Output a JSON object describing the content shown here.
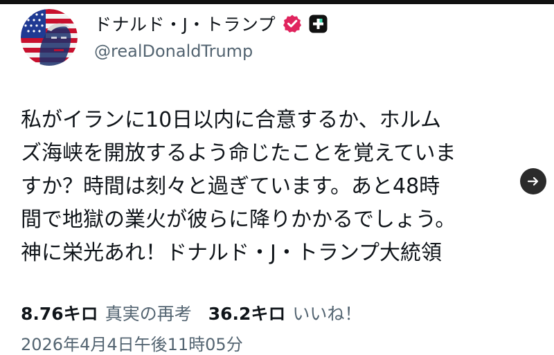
{
  "author": {
    "display_name": "ドナルド・J・トランプ",
    "handle": "@realDonaldTrump",
    "avatar_icon": "flag-portrait-avatar",
    "verified_icon": "verified-badge-icon",
    "verified_color": "#e0245e",
    "subscription_icon": "plus-badge-icon"
  },
  "tweet": {
    "lines": [
      "私がイランに10日以内に合意するか、ホルム",
      "ズ海峡を開放するよう命じたことを覚えていま",
      "すか？時間は刻々と過ぎています。あと48時",
      "間で地獄の業火が彼らに降りかかるでしょう。",
      "神に栄光あれ！ドナルド・J・トランプ大統領"
    ]
  },
  "stats": {
    "retruths_value": "8.76キロ",
    "retruths_label": "真実の再考",
    "likes_value": "36.2キロ",
    "likes_label": "いいね！"
  },
  "timestamp": "2026年4月4日午後11時05分",
  "next_button_icon": "arrow-right-icon"
}
